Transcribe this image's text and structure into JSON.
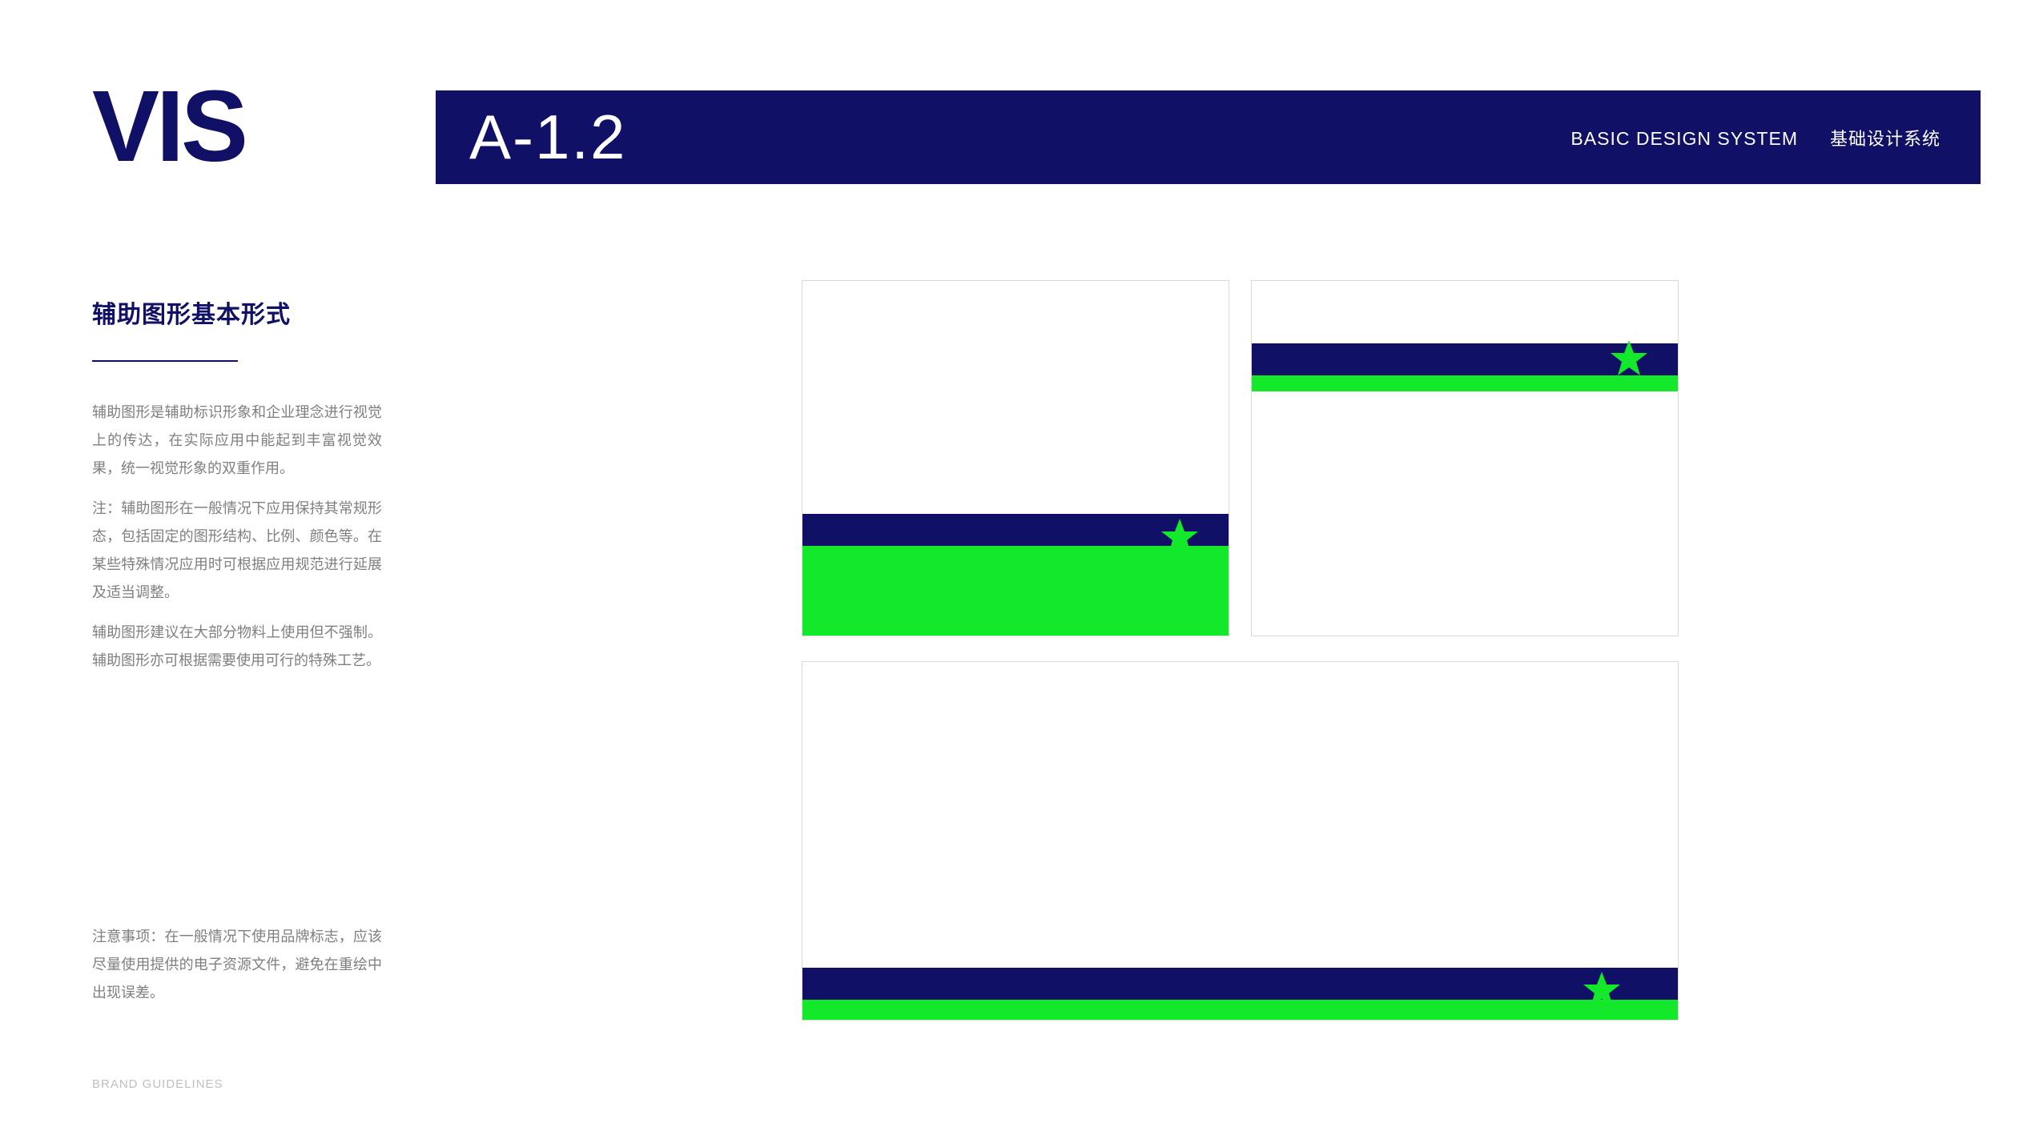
{
  "logo": "VIS",
  "header": {
    "code": "A-1.2",
    "en": "BASIC DESIGN SYSTEM",
    "cn": "基础设计系统"
  },
  "section_title": "辅助图形基本形式",
  "paragraphs": {
    "p1": "辅助图形是辅助标识形象和企业理念进行视觉上的传达，在实际应用中能起到丰富视觉效果，统一视觉形象的双重作用。",
    "p2": "注：辅助图形在一般情况下应用保持其常规形态，包括固定的图形结构、比例、颜色等。在某些特殊情况应用时可根据应用规范进行延展及适当调整。",
    "p3": "辅助图形建议在大部分物料上使用但不强制。辅助图形亦可根据需要使用可行的特殊工艺。",
    "p4": "注意事项：在一般情况下使用品牌标志，应该尽量使用提供的电子资源文件，避免在重绘中出现误差。"
  },
  "footer": "BRAND GUIDELINES",
  "colors": {
    "navy": "#0f1066",
    "green": "#13e82a"
  }
}
